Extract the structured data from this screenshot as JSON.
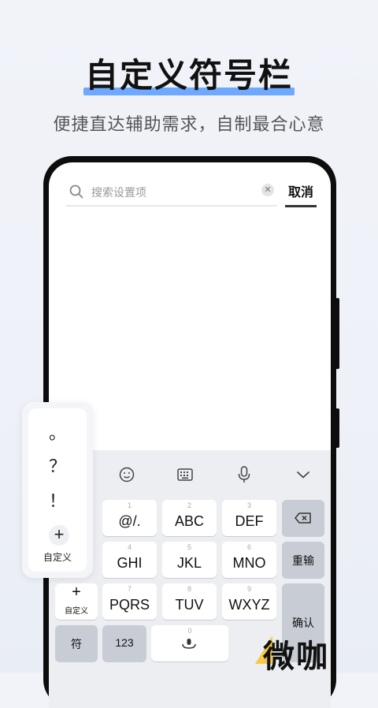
{
  "headline": "自定义符号栏",
  "subtitle": "便捷直达辅助需求，自制最合心意",
  "search": {
    "placeholder": "搜索设置项",
    "cancel_label": "取消"
  },
  "toolbar": {
    "icons": [
      "emoji-icon",
      "keyboard-icon",
      "microphone-icon",
      "collapse-chevron-icon"
    ]
  },
  "keys": {
    "row1": [
      {
        "num": "1",
        "label": "@/."
      },
      {
        "num": "2",
        "label": "ABC"
      },
      {
        "num": "3",
        "label": "DEF"
      }
    ],
    "row2": [
      {
        "num": "4",
        "label": "GHI"
      },
      {
        "num": "5",
        "label": "JKL"
      },
      {
        "num": "6",
        "label": "MNO"
      }
    ],
    "row3": [
      {
        "num": "7",
        "label": "PQRS"
      },
      {
        "num": "8",
        "label": "TUV"
      },
      {
        "num": "9",
        "label": "WXYZ"
      }
    ],
    "reenter": "重输",
    "confirm": "确认",
    "symbol": "符",
    "numbers": "123",
    "space_num": "0"
  },
  "symbol_bar": {
    "symbols": [
      "。",
      "？",
      "！"
    ],
    "add_symbol": "+",
    "add_label": "自定义"
  },
  "custom_key": {
    "plus": "+",
    "label": "自定义"
  },
  "watermark": "微咖",
  "colors": {
    "accent": "#5fa0ff",
    "watermark_yellow": "#f7c948"
  }
}
